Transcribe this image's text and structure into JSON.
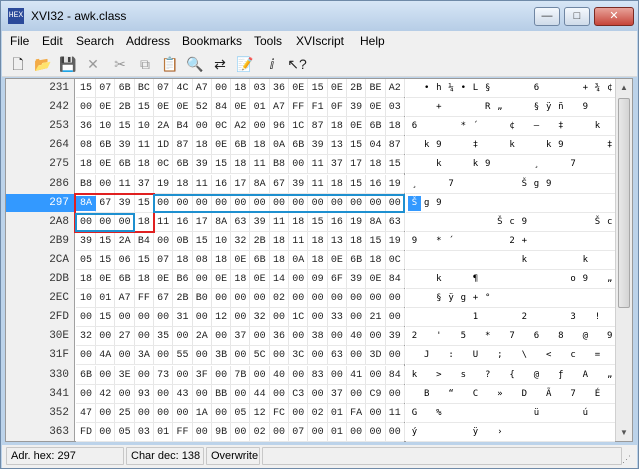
{
  "window": {
    "title": "XVI32 - awk.class",
    "app_icon": "HEX",
    "minimize": "—",
    "maximize": "□",
    "close": "✕"
  },
  "menu": [
    "File",
    "Edit",
    "Search",
    "Address",
    "Bookmarks",
    "Tools",
    "XVIscript",
    "Help"
  ],
  "toolbar": [
    {
      "name": "new-file-icon",
      "glyph": "🗋",
      "enabled": true
    },
    {
      "name": "open-folder-icon",
      "glyph": "📂",
      "enabled": true
    },
    {
      "name": "save-disk-icon",
      "glyph": "💾",
      "enabled": true
    },
    {
      "name": "delete-x-icon",
      "glyph": "✕",
      "enabled": false
    },
    {
      "name": "cut-scissors-icon",
      "glyph": "✂",
      "enabled": false
    },
    {
      "name": "copy-icon",
      "glyph": "⧉",
      "enabled": false
    },
    {
      "name": "paste-icon",
      "glyph": "📋",
      "enabled": true
    },
    {
      "name": "find-magnifier-icon",
      "glyph": "🔍",
      "enabled": true
    },
    {
      "name": "replace-icon",
      "glyph": "⇄",
      "enabled": true
    },
    {
      "name": "script-icon",
      "glyph": "📝",
      "enabled": true
    },
    {
      "name": "info-icon",
      "glyph": "ⅈ",
      "enabled": true
    },
    {
      "name": "help-pointer-icon",
      "glyph": "↖?",
      "enabled": true
    }
  ],
  "rows": [
    {
      "addr": "231",
      "hex": [
        "15",
        "07",
        "6B",
        "BC",
        "07",
        "4C",
        "A7",
        "00",
        "18",
        "03",
        "36",
        "0E",
        "15",
        "0E",
        "2B",
        "BE",
        "A2"
      ],
      "ascii": [
        "",
        "•",
        "h",
        "¼",
        "•",
        "L",
        "§",
        "",
        "",
        "",
        "6",
        "",
        "",
        "",
        "+",
        "¾",
        "¢"
      ]
    },
    {
      "addr": "242",
      "hex": [
        "00",
        "0E",
        "2B",
        "15",
        "0E",
        "0E",
        "52",
        "84",
        "0E",
        "01",
        "A7",
        "FF",
        "F1",
        "0F",
        "39",
        "0E",
        "03"
      ],
      "ascii": [
        "",
        "",
        "+",
        "",
        "",
        "",
        "R",
        "„",
        "",
        "",
        "§",
        "ÿ",
        "ñ",
        "",
        "9",
        "",
        ""
      ]
    },
    {
      "addr": "253",
      "hex": [
        "36",
        "10",
        "15",
        "10",
        "2A",
        "B4",
        "00",
        "0C",
        "A2",
        "00",
        "96",
        "1C",
        "87",
        "18",
        "0E",
        "6B",
        "18"
      ],
      "ascii": [
        "6",
        "",
        "",
        "",
        "*",
        "´",
        "",
        "",
        "¢",
        "",
        "–",
        "",
        "‡",
        "",
        "",
        "k",
        ""
      ]
    },
    {
      "addr": "264",
      "hex": [
        "08",
        "6B",
        "39",
        "11",
        "1D",
        "87",
        "18",
        "0E",
        "6B",
        "18",
        "0A",
        "6B",
        "39",
        "13",
        "15",
        "04",
        "87"
      ],
      "ascii": [
        "",
        "k",
        "9",
        "",
        "",
        "‡",
        "",
        "",
        "k",
        "",
        "",
        "k",
        "9",
        "",
        "",
        "",
        "‡"
      ]
    },
    {
      "addr": "275",
      "hex": [
        "18",
        "0E",
        "6B",
        "18",
        "0C",
        "6B",
        "39",
        "15",
        "18",
        "11",
        "B8",
        "00",
        "11",
        "37",
        "17",
        "18",
        "15"
      ],
      "ascii": [
        "",
        "",
        "k",
        "",
        "",
        "k",
        "9",
        "",
        "",
        "",
        "¸",
        "",
        "",
        "7",
        "",
        "",
        ""
      ]
    },
    {
      "addr": "286",
      "hex": [
        "B8",
        "00",
        "11",
        "37",
        "19",
        "18",
        "11",
        "16",
        "17",
        "8A",
        "67",
        "39",
        "11",
        "18",
        "15",
        "16",
        "19"
      ],
      "ascii": [
        "¸",
        "",
        "",
        "7",
        "",
        "",
        "",
        "",
        "",
        "Š",
        "g",
        "9",
        "",
        "",
        "",
        "",
        ""
      ]
    },
    {
      "addr": "297",
      "hex": [
        "8A",
        "67",
        "39",
        "15",
        "00",
        "00",
        "00",
        "00",
        "00",
        "00",
        "00",
        "00",
        "00",
        "00",
        "00",
        "00",
        "00"
      ],
      "ascii": [
        "Š",
        "g",
        "9",
        "",
        "",
        "",
        "",
        "",
        "",
        "",
        "",
        "",
        "",
        "",
        "",
        "",
        ""
      ]
    },
    {
      "addr": "2A8",
      "hex": [
        "00",
        "00",
        "00",
        "18",
        "11",
        "16",
        "17",
        "8A",
        "63",
        "39",
        "11",
        "18",
        "15",
        "16",
        "19",
        "8A",
        "63"
      ],
      "ascii": [
        "",
        "",
        "",
        "",
        "",
        "",
        "",
        "Š",
        "c",
        "9",
        "",
        "",
        "",
        "",
        "",
        "Š",
        "c"
      ]
    },
    {
      "addr": "2B9",
      "hex": [
        "39",
        "15",
        "2A",
        "B4",
        "00",
        "0B",
        "15",
        "10",
        "32",
        "2B",
        "18",
        "11",
        "18",
        "13",
        "18",
        "15",
        "19"
      ],
      "ascii": [
        "9",
        "",
        "*",
        "´",
        "",
        "",
        "",
        "",
        "2",
        "+",
        "",
        "",
        "",
        "",
        "",
        "",
        ""
      ]
    },
    {
      "addr": "2CA",
      "hex": [
        "05",
        "15",
        "06",
        "15",
        "07",
        "18",
        "08",
        "18",
        "0E",
        "6B",
        "18",
        "0A",
        "18",
        "0E",
        "6B",
        "18",
        "0C"
      ],
      "ascii": [
        "",
        "",
        "",
        "",
        "",
        "",
        "",
        "",
        "",
        "k",
        "",
        "",
        "",
        "",
        "k",
        "",
        ""
      ]
    },
    {
      "addr": "2DB",
      "hex": [
        "18",
        "0E",
        "6B",
        "18",
        "0E",
        "B6",
        "00",
        "0E",
        "18",
        "0E",
        "14",
        "00",
        "09",
        "6F",
        "39",
        "0E",
        "84"
      ],
      "ascii": [
        "",
        "",
        "k",
        "",
        "",
        "¶",
        "",
        "",
        "",
        "",
        "",
        "",
        "",
        "o",
        "9",
        "",
        "„"
      ]
    },
    {
      "addr": "2EC",
      "hex": [
        "10",
        "01",
        "A7",
        "FF",
        "67",
        "2B",
        "B0",
        "00",
        "00",
        "00",
        "02",
        "00",
        "00",
        "00",
        "00",
        "00",
        "00"
      ],
      "ascii": [
        "",
        "",
        "§",
        "ÿ",
        "g",
        "+",
        "°",
        "",
        "",
        "",
        "",
        "",
        "",
        "",
        "",
        "",
        ""
      ]
    },
    {
      "addr": "2FD",
      "hex": [
        "00",
        "15",
        "00",
        "00",
        "00",
        "31",
        "00",
        "12",
        "00",
        "32",
        "00",
        "1C",
        "00",
        "33",
        "00",
        "21",
        "00"
      ],
      "ascii": [
        "",
        "",
        "",
        "",
        "",
        "1",
        "",
        "",
        "",
        "2",
        "",
        "",
        "",
        "3",
        "",
        "!",
        ""
      ]
    },
    {
      "addr": "30E",
      "hex": [
        "32",
        "00",
        "27",
        "00",
        "35",
        "00",
        "2A",
        "00",
        "37",
        "00",
        "36",
        "00",
        "38",
        "00",
        "40",
        "00",
        "39"
      ],
      "ascii": [
        "2",
        "",
        "'",
        "",
        "5",
        "",
        "*",
        "",
        "7",
        "",
        "6",
        "",
        "8",
        "",
        "@",
        "",
        "9"
      ]
    },
    {
      "addr": "31F",
      "hex": [
        "00",
        "4A",
        "00",
        "3A",
        "00",
        "55",
        "00",
        "3B",
        "00",
        "5C",
        "00",
        "3C",
        "00",
        "63",
        "00",
        "3D",
        "00"
      ],
      "ascii": [
        "",
        "J",
        "",
        ":",
        "",
        "U",
        "",
        ";",
        "",
        "\\",
        "",
        "<",
        "",
        "c",
        "",
        "=",
        ""
      ]
    },
    {
      "addr": "330",
      "hex": [
        "6B",
        "00",
        "3E",
        "00",
        "73",
        "00",
        "3F",
        "00",
        "7B",
        "00",
        "40",
        "00",
        "83",
        "00",
        "41",
        "00",
        "84"
      ],
      "ascii": [
        "k",
        "",
        ">",
        "",
        "s",
        "",
        "?",
        "",
        "{",
        "",
        "@",
        "",
        "ƒ",
        "",
        "A",
        "",
        "„"
      ]
    },
    {
      "addr": "341",
      "hex": [
        "00",
        "42",
        "00",
        "93",
        "00",
        "43",
        "00",
        "BB",
        "00",
        "44",
        "00",
        "C3",
        "00",
        "37",
        "00",
        "C9",
        "00"
      ],
      "ascii": [
        "",
        "B",
        "",
        "“",
        "",
        "C",
        "",
        "»",
        "",
        "D",
        "",
        "Ã",
        "",
        "7",
        "",
        "É",
        ""
      ]
    },
    {
      "addr": "352",
      "hex": [
        "47",
        "00",
        "25",
        "00",
        "00",
        "00",
        "1A",
        "00",
        "05",
        "12",
        "FC",
        "00",
        "02",
        "01",
        "FA",
        "00",
        "11"
      ],
      "ascii": [
        "G",
        "",
        "%",
        "",
        "",
        "",
        "",
        "",
        "",
        "",
        "ü",
        "",
        "",
        "",
        "ú",
        "",
        ""
      ]
    },
    {
      "addr": "363",
      "hex": [
        "FD",
        "00",
        "05",
        "03",
        "01",
        "FF",
        "00",
        "9B",
        "00",
        "02",
        "00",
        "07",
        "00",
        "01",
        "00",
        "00",
        "00"
      ],
      "ascii": [
        "ý",
        "",
        "",
        "",
        "",
        "ÿ",
        "",
        "›",
        "",
        "",
        "",
        "",
        "",
        "",
        "",
        "",
        ""
      ]
    }
  ],
  "status": {
    "address": "Adr. hex: 297",
    "char": "Char dec: 138",
    "mode": "Overwrite"
  },
  "colors": {
    "selection": "#3399ff",
    "red_marker": "#e02020",
    "blue_marker": "#1e90d0"
  }
}
